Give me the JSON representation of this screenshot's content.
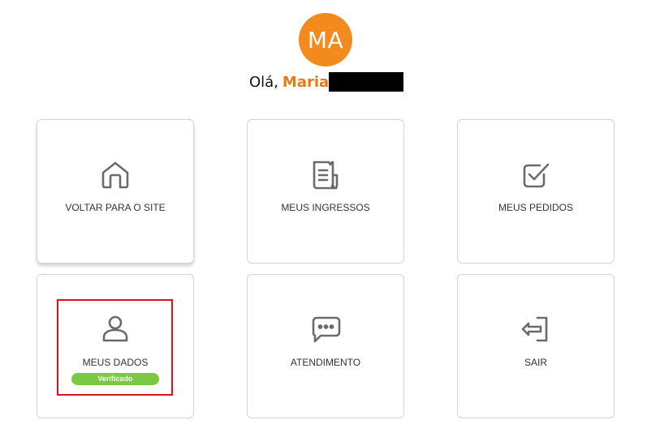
{
  "user": {
    "initials": "MA",
    "greeting": "Olá,",
    "name": "Maria"
  },
  "menu": {
    "home": {
      "label": "VOLTAR PARA O SITE",
      "icon": "home-icon"
    },
    "tickets": {
      "label": "MEUS INGRESSOS",
      "icon": "receipt-icon"
    },
    "orders": {
      "label": "MEUS PEDIDOS",
      "icon": "checkbox-icon"
    },
    "profile": {
      "label": "MEUS DADOS",
      "icon": "user-icon",
      "badge": "Verificado"
    },
    "support": {
      "label": "ATENDIMENTO",
      "icon": "chat-bubble-icon"
    },
    "logout": {
      "label": "SAIR",
      "icon": "logout-icon"
    }
  },
  "colors": {
    "accent": "#f28a1e",
    "name_text": "#e87a12",
    "badge_green": "#7ac943",
    "highlight_red": "#e0111b",
    "icon_gray": "#6b6b6b"
  }
}
